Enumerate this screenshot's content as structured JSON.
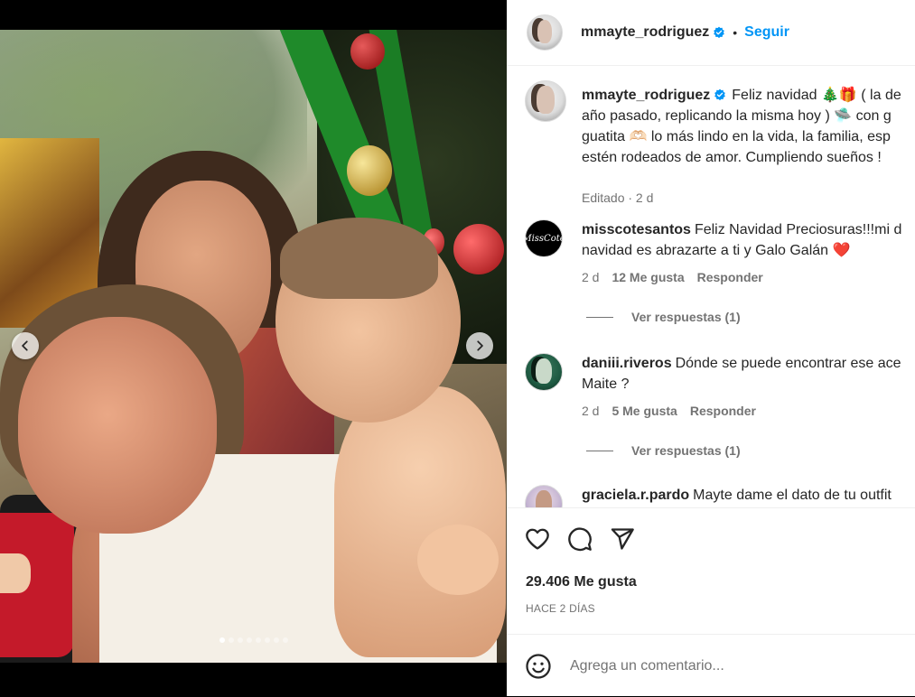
{
  "post": {
    "author": "mmayte_rodriguez",
    "follow_label": "Seguir",
    "separator": "•",
    "caption_lines": [
      "Feliz navidad 🎄🎁 ( la de",
      "año pasado, replicando la misma hoy ) 🛸 con g",
      "guatita 🫶🏻 lo más lindo en la vida, la familia, esp",
      "estén rodeados de amor. Cumpliendo sueños !"
    ],
    "caption_meta": "Editado · 2 d",
    "likes": "29.406 Me gusta",
    "time_ago": "HACE 2 DÍAS",
    "carousel_dots": 8,
    "carousel_active": 0
  },
  "comments": [
    {
      "user": "misscotesantos",
      "avatar_text": "MissCote",
      "lines": [
        "Feliz Navidad Preciosuras!!!mi d",
        "navidad es abrazarte a ti y Galo Galán ❤️"
      ],
      "age": "2 d",
      "likes": "12 Me gusta",
      "reply": "Responder",
      "view_replies": "Ver respuestas (1)"
    },
    {
      "user": "daniii.riveros",
      "lines": [
        "Dónde se puede encontrar ese ace",
        "Maite ?"
      ],
      "age": "2 d",
      "likes": "5 Me gusta",
      "reply": "Responder",
      "view_replies": "Ver respuestas (1)"
    },
    {
      "user": "graciela.r.pardo",
      "lines": [
        "Mayte dame el dato de tu outfit"
      ]
    }
  ],
  "add_comment": {
    "placeholder": "Agrega un comentario..."
  },
  "colors": {
    "accent": "#0095f6",
    "verified": "#0095f6",
    "muted": "#737373",
    "text": "#262626"
  }
}
